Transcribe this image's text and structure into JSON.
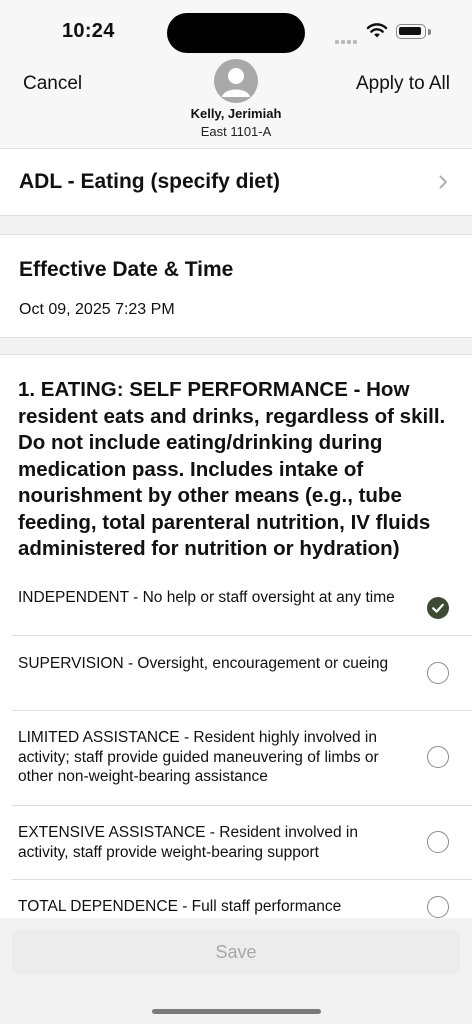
{
  "status_bar": {
    "time": "10:24"
  },
  "nav": {
    "cancel_label": "Cancel",
    "apply_label": "Apply to All",
    "resident_name": "Kelly, Jerimiah",
    "resident_room": "East 1101-A"
  },
  "adl": {
    "title": "ADL - Eating (specify diet)"
  },
  "effective": {
    "title": "Effective Date & Time",
    "value": "Oct 09, 2025 7:23 PM"
  },
  "question": {
    "text": "1. EATING: SELF PERFORMANCE - How resident eats and drinks, regardless of skill. Do not include eating/drinking during medication pass. Includes intake of nourishment by other means (e.g., tube feeding, total parenteral nutrition, IV fluids administered for nutrition or hydration)",
    "options": [
      {
        "label": "INDEPENDENT - No help or staff oversight at any time",
        "selected": true
      },
      {
        "label": "SUPERVISION - Oversight, encouragement or cueing",
        "selected": false
      },
      {
        "label": "LIMITED ASSISTANCE - Resident highly involved in activity; staff provide guided maneuvering of limbs or other non-weight-bearing assistance",
        "selected": false
      },
      {
        "label": "EXTENSIVE ASSISTANCE - Resident involved in activity, staff provide weight-bearing support",
        "selected": false
      },
      {
        "label": "TOTAL DEPENDENCE - Full staff performance",
        "selected": false
      }
    ]
  },
  "footer": {
    "save_label": "Save"
  },
  "colors": {
    "selected_radio": "#3f4a33",
    "disabled_text": "#a8a8a8"
  }
}
